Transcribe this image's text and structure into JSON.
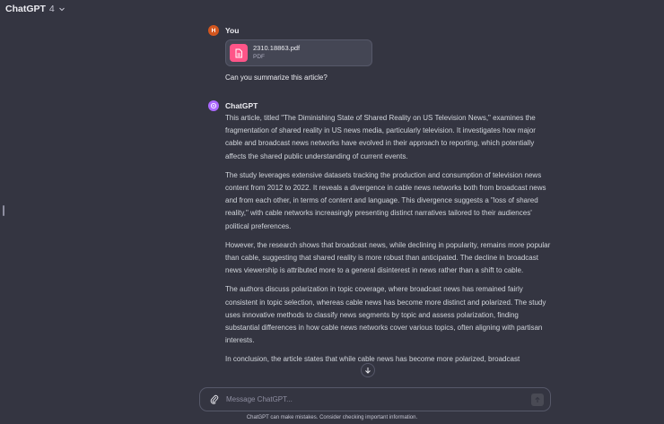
{
  "header": {
    "model_name": "ChatGPT",
    "model_version": "4"
  },
  "user_message": {
    "author": "You",
    "avatar_initial": "H",
    "attachment": {
      "file_name": "2310.18863.pdf",
      "file_type": "PDF",
      "icon": "document-icon"
    },
    "text": "Can you summarize this article?"
  },
  "assistant_message": {
    "author": "ChatGPT",
    "paragraphs": [
      "This article, titled \"The Diminishing State of Shared Reality on US Television News,\" examines the fragmentation of shared reality in US news media, particularly television. It investigates how major cable and broadcast news networks have evolved in their approach to reporting, which potentially affects the shared public understanding of current events.",
      "The study leverages extensive datasets tracking the production and consumption of television news content from 2012 to 2022. It reveals a divergence in cable news networks both from broadcast news and from each other, in terms of content and language. This divergence suggests a \"loss of shared reality,\" with cable networks increasingly presenting distinct narratives tailored to their audiences' political preferences.",
      "However, the research shows that broadcast news, while declining in popularity, remains more popular than cable, suggesting that shared reality is more robust than anticipated. The decline in broadcast news viewership is attributed more to a general disinterest in news rather than a shift to cable.",
      "The authors discuss polarization in topic coverage, where broadcast news has remained fairly consistent in topic selection, whereas cable news has become more distinct and polarized. The study uses innovative methods to classify news segments by topic and assess polarization, finding substantial differences in how cable news networks cover various topics, often aligning with partisan interests.",
      "In conclusion, the article states that while cable news has become more polarized, broadcast"
    ]
  },
  "composer": {
    "placeholder": "Message ChatGPT..."
  },
  "footer": {
    "disclaimer": "ChatGPT can make mistakes. Consider checking important information."
  },
  "colors": {
    "background": "#343541",
    "user_avatar": "#d3561e",
    "assistant_avatar": "#ab68ff",
    "pdf_icon": "#ff5588"
  }
}
